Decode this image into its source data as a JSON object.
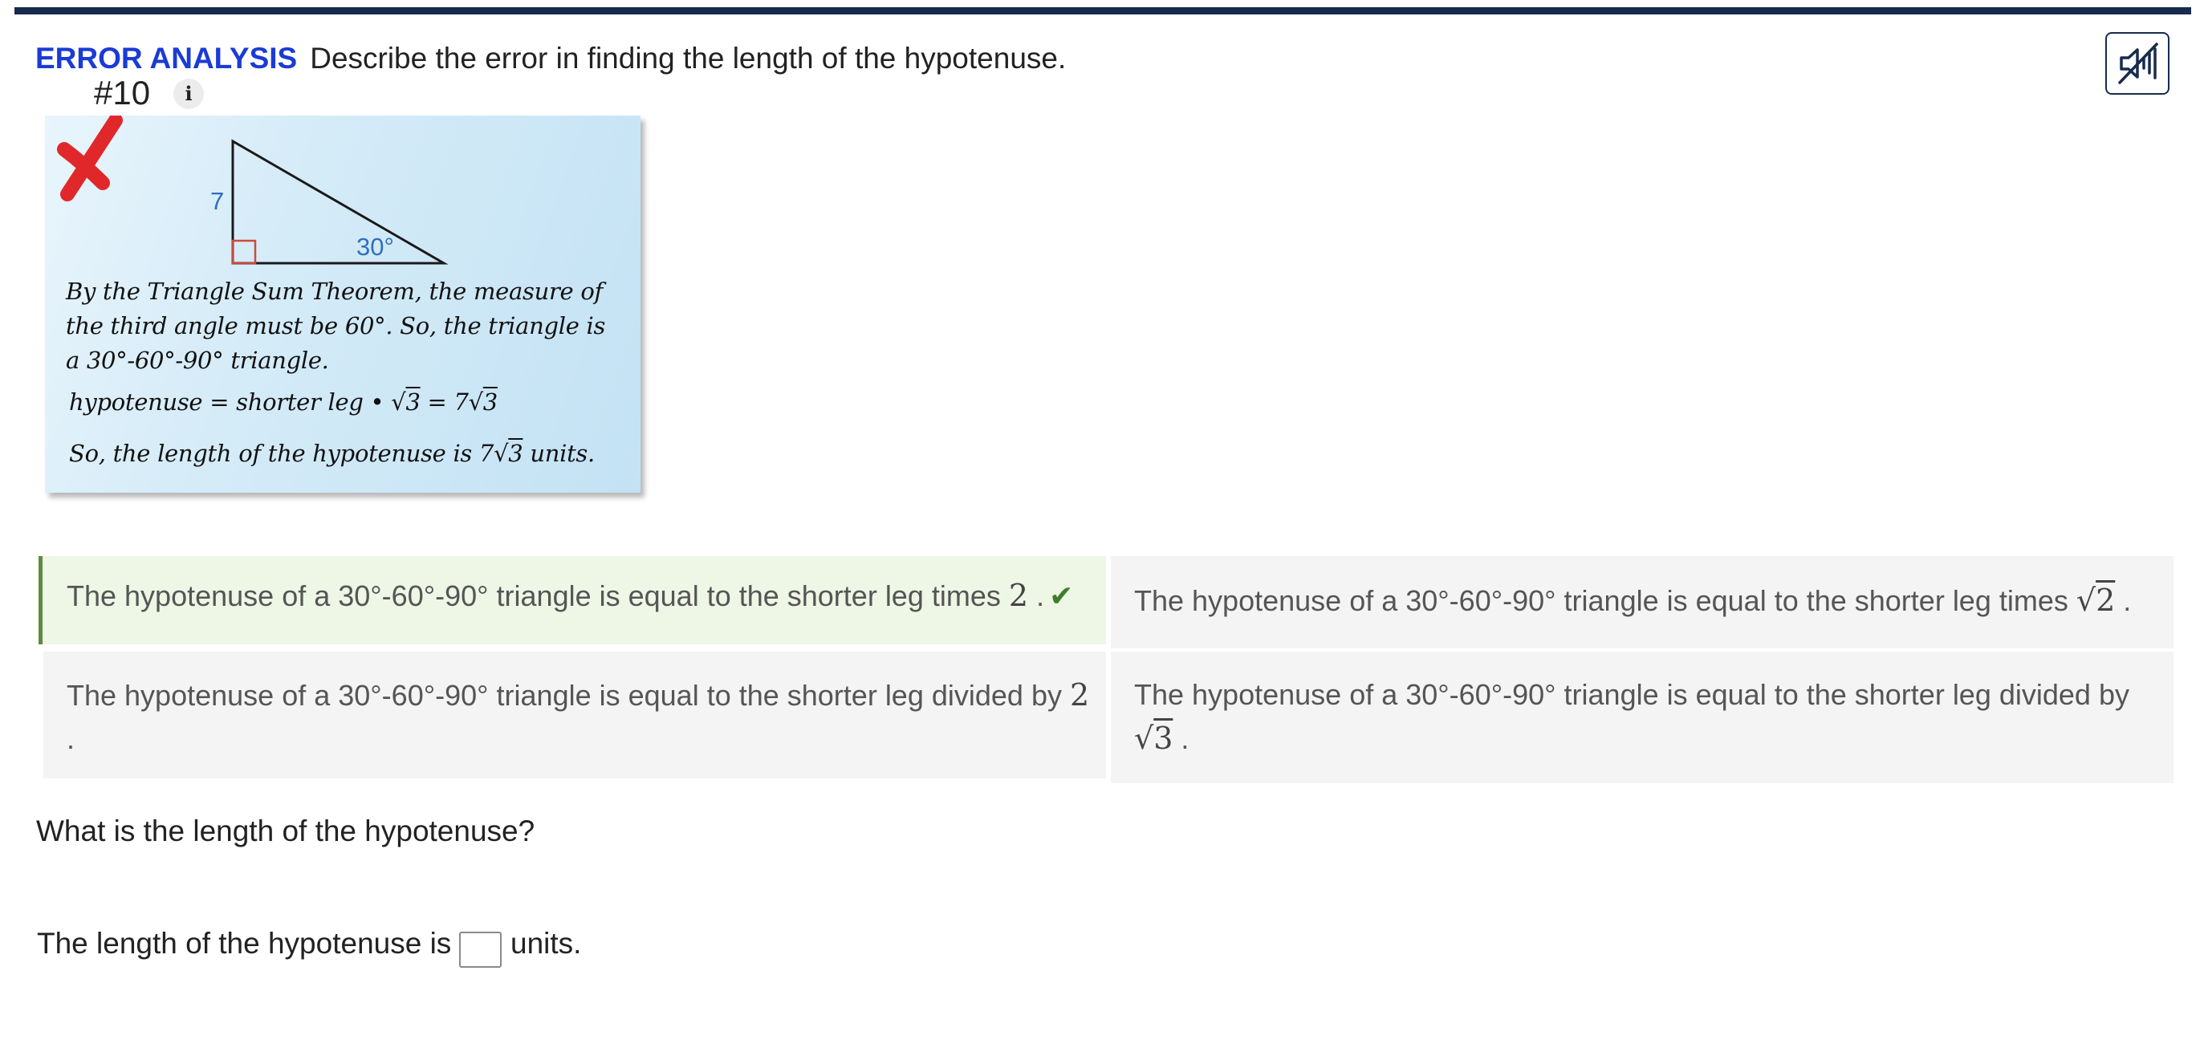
{
  "header": {
    "tag": "ERROR ANALYSIS",
    "prompt": "Describe the error in finding the length of the hypotenuse.",
    "question_number": "#10",
    "info_glyph": "i"
  },
  "audio_button": {
    "icon": "speaker-muted-icon"
  },
  "figure": {
    "error_mark": "✗",
    "side_label": "7",
    "angle_label": "30°",
    "text_lines": [
      "By the Triangle Sum Theorem, the measure of",
      "the third angle must be 60°. So, the triangle is",
      "a 30°-60°-90° triangle."
    ],
    "equation": {
      "left": "hypotenuse = shorter leg •",
      "mid": "= 7",
      "radicand": "3"
    },
    "conclusion": {
      "before": "So, the length of the hypotenuse is 7",
      "radicand": "3",
      "after": " units."
    }
  },
  "choices": [
    {
      "text": "The hypotenuse of a 30°-60°-90° triangle is equal to the shorter leg times ",
      "math": "2",
      "end": " .",
      "selected": true,
      "mark": "✔"
    },
    {
      "text": "The hypotenuse of a 30°-60°-90° triangle is equal to the shorter leg times ",
      "math": "2",
      "end": " .",
      "selected": false
    },
    {
      "text": "The hypotenuse of a 30°-60°-90° triangle is equal to the shorter leg divided by ",
      "math": "2",
      "end": ".",
      "selected": false
    },
    {
      "text": "The hypotenuse of a 30°-60°-90° triangle is equal to the shorter leg divided by ",
      "math": "3",
      "end": " .",
      "selected": false
    }
  ],
  "question2": "What is the length of the hypotenuse?",
  "answer": {
    "prefix": "The length of the hypotenuse is",
    "value": "",
    "suffix": "units."
  },
  "colors": {
    "brand": "#172b4d",
    "accent": "#1a3bd6",
    "correct": "#3f7d2a",
    "error": "#e0282b"
  }
}
